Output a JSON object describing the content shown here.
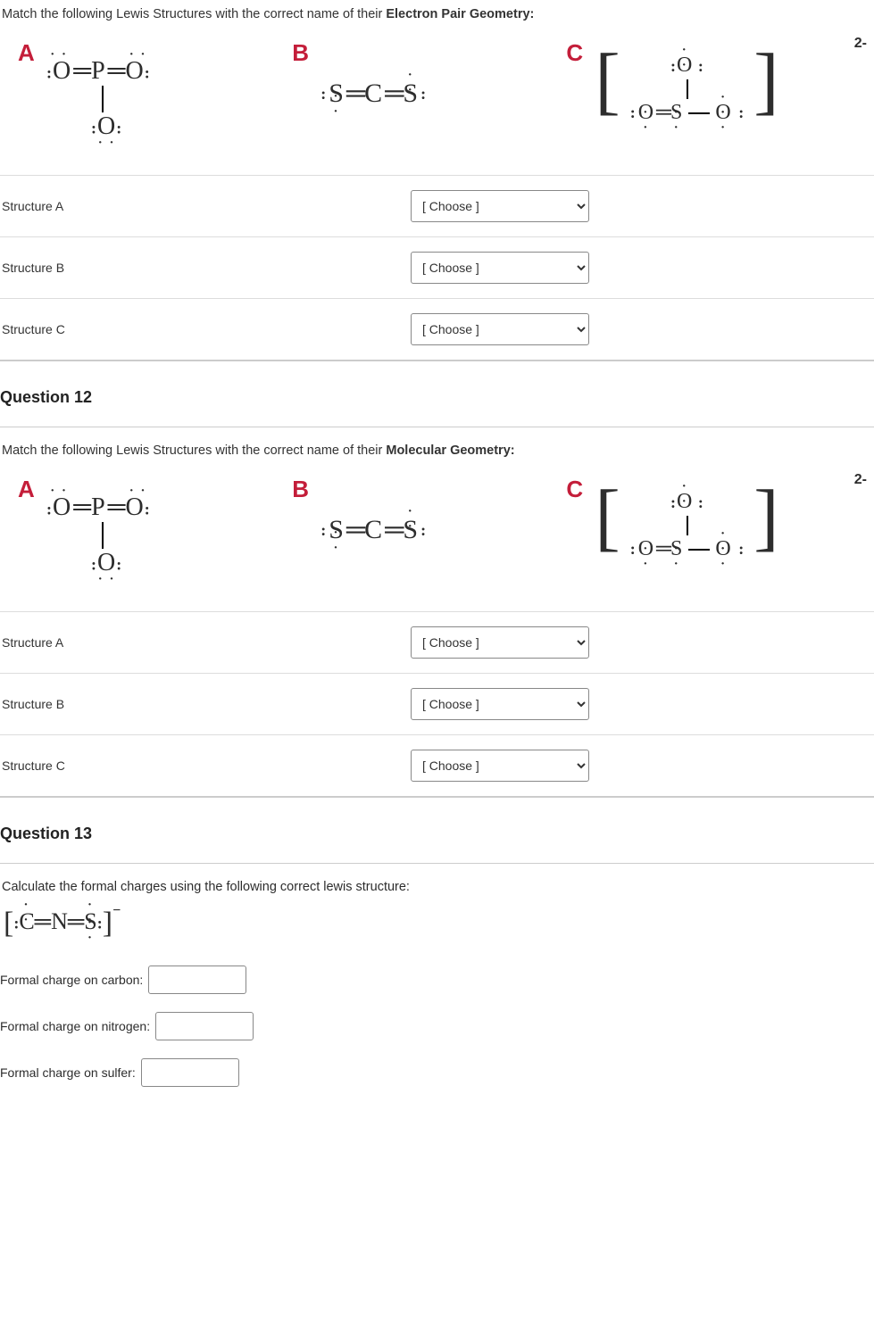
{
  "q11": {
    "prompt_a": "Match the following Lewis Structures with the correct name of their ",
    "prompt_b": "Electron Pair Geometry:",
    "labels": {
      "A": "A",
      "B": "B",
      "C": "C"
    },
    "charge_c": "2-",
    "rows": [
      {
        "label": "Structure A",
        "placeholder": "[ Choose ]"
      },
      {
        "label": "Structure B",
        "placeholder": "[ Choose ]"
      },
      {
        "label": "Structure C",
        "placeholder": "[ Choose ]"
      }
    ]
  },
  "q12": {
    "header": "Question 12",
    "prompt_a": "Match the following Lewis Structures with the correct name of their ",
    "prompt_b": "Molecular Geometry:",
    "labels": {
      "A": "A",
      "B": "B",
      "C": "C"
    },
    "charge_c": "2-",
    "rows": [
      {
        "label": "Structure A",
        "placeholder": "[ Choose ]"
      },
      {
        "label": "Structure B",
        "placeholder": "[ Choose ]"
      },
      {
        "label": "Structure C",
        "placeholder": "[ Choose ]"
      }
    ]
  },
  "q13": {
    "header": "Question 13",
    "prompt": "Calculate the formal charges using the following correct lewis structure:",
    "fc_labels": {
      "carbon": "Formal charge on carbon:",
      "nitrogen": "Formal charge on nitrogen:",
      "sulfer": "Formal charge on sulfer:"
    }
  }
}
